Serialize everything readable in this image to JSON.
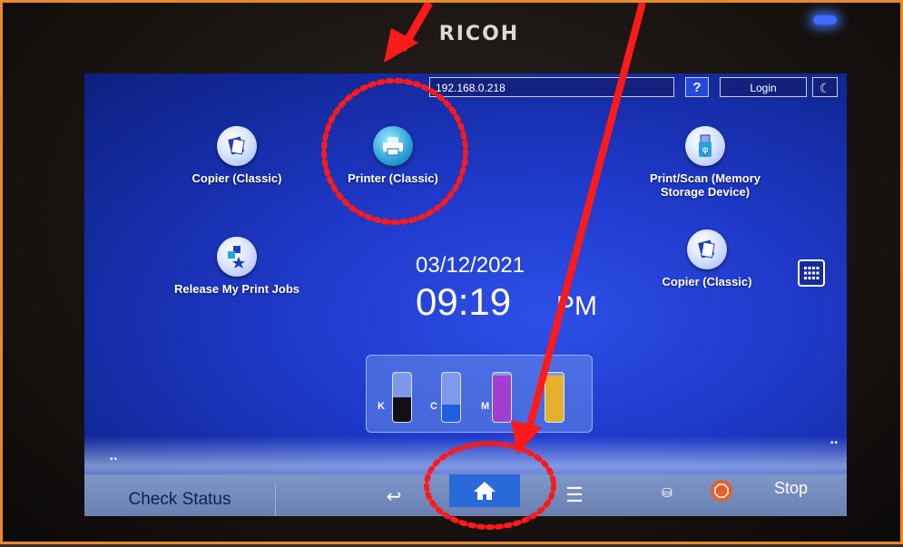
{
  "device": {
    "brand": "RICOH"
  },
  "topbar": {
    "address": "192.168.0.218",
    "help_label": "?",
    "login_label": "Login",
    "sleep_icon": "moon-icon"
  },
  "apps": [
    {
      "label": "Copier (Classic)",
      "icon": "copier-icon"
    },
    {
      "label": "Printer (Classic)",
      "icon": "printer-icon"
    },
    {
      "label": "Print/Scan (Memory Storage Device)",
      "icon": "usb-icon"
    },
    {
      "label": "Release My Print Jobs",
      "icon": "release-jobs-icon"
    },
    {
      "label": "Copier (Classic)",
      "icon": "copier-icon"
    }
  ],
  "clock": {
    "date": "03/12/2021",
    "time": "09:19",
    "ampm": "PM"
  },
  "toner": [
    {
      "label": "K",
      "level": 0.5,
      "color": "#111111"
    },
    {
      "label": "C",
      "level": 0.35,
      "color": "#1d5fe0"
    },
    {
      "label": "M",
      "level": 0.95,
      "color": "#a23fd0"
    },
    {
      "label": "Y",
      "level": 0.95,
      "color": "#e3b12c"
    }
  ],
  "bottombar": {
    "check_status": "Check Status",
    "stop_label": "Stop"
  },
  "colors": {
    "annotation": "#ff1a1a",
    "frame": "#e8892b",
    "home_active": "#2a6ad8"
  }
}
